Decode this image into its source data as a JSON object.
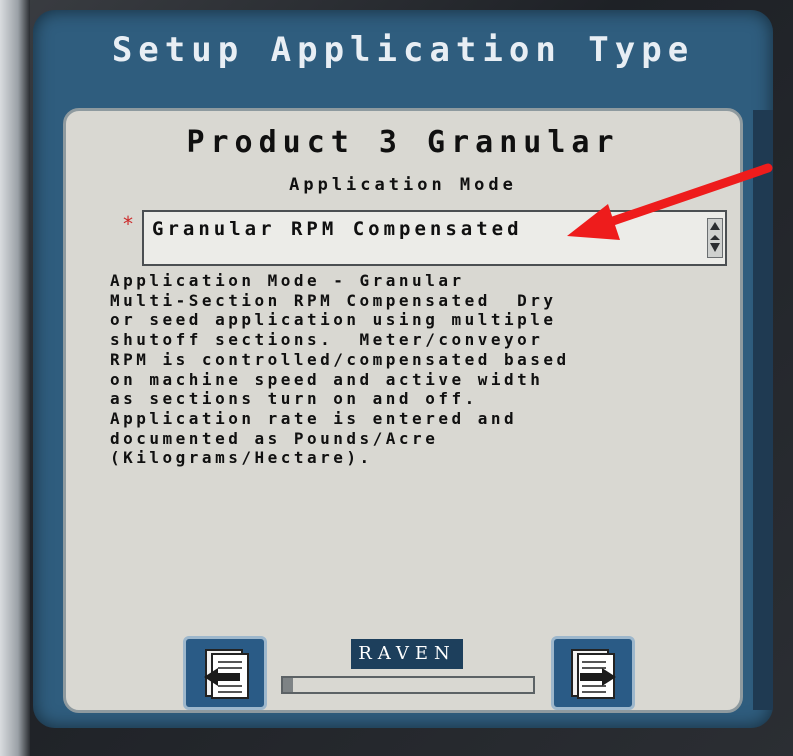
{
  "screen": {
    "title": "Setup Application Type"
  },
  "panel": {
    "product_title": "Product 3 Granular",
    "mode_label": "Application Mode",
    "required_marker": "*",
    "mode_select": {
      "value": "Granular RPM Compensated"
    },
    "description": "Application Mode - Granular\nMulti-Section RPM Compensated  Dry\nor seed application using multiple\nshutoff sections.  Meter/conveyor\nRPM is controlled/compensated based\non machine speed and active width\nas sections turn on and off.\nApplication rate is entered and\ndocumented as Pounds/Acre\n(Kilograms/Hectare)."
  },
  "footer": {
    "brand": "RAVEN",
    "progress": 0.04,
    "back_icon": "back-page-icon",
    "next_icon": "next-page-icon"
  },
  "colors": {
    "screen_bg": "#2f5d7e",
    "panel_bg": "#d9d8d2",
    "required": "#cc2a2a",
    "annotation_arrow": "#ee1c1c"
  }
}
